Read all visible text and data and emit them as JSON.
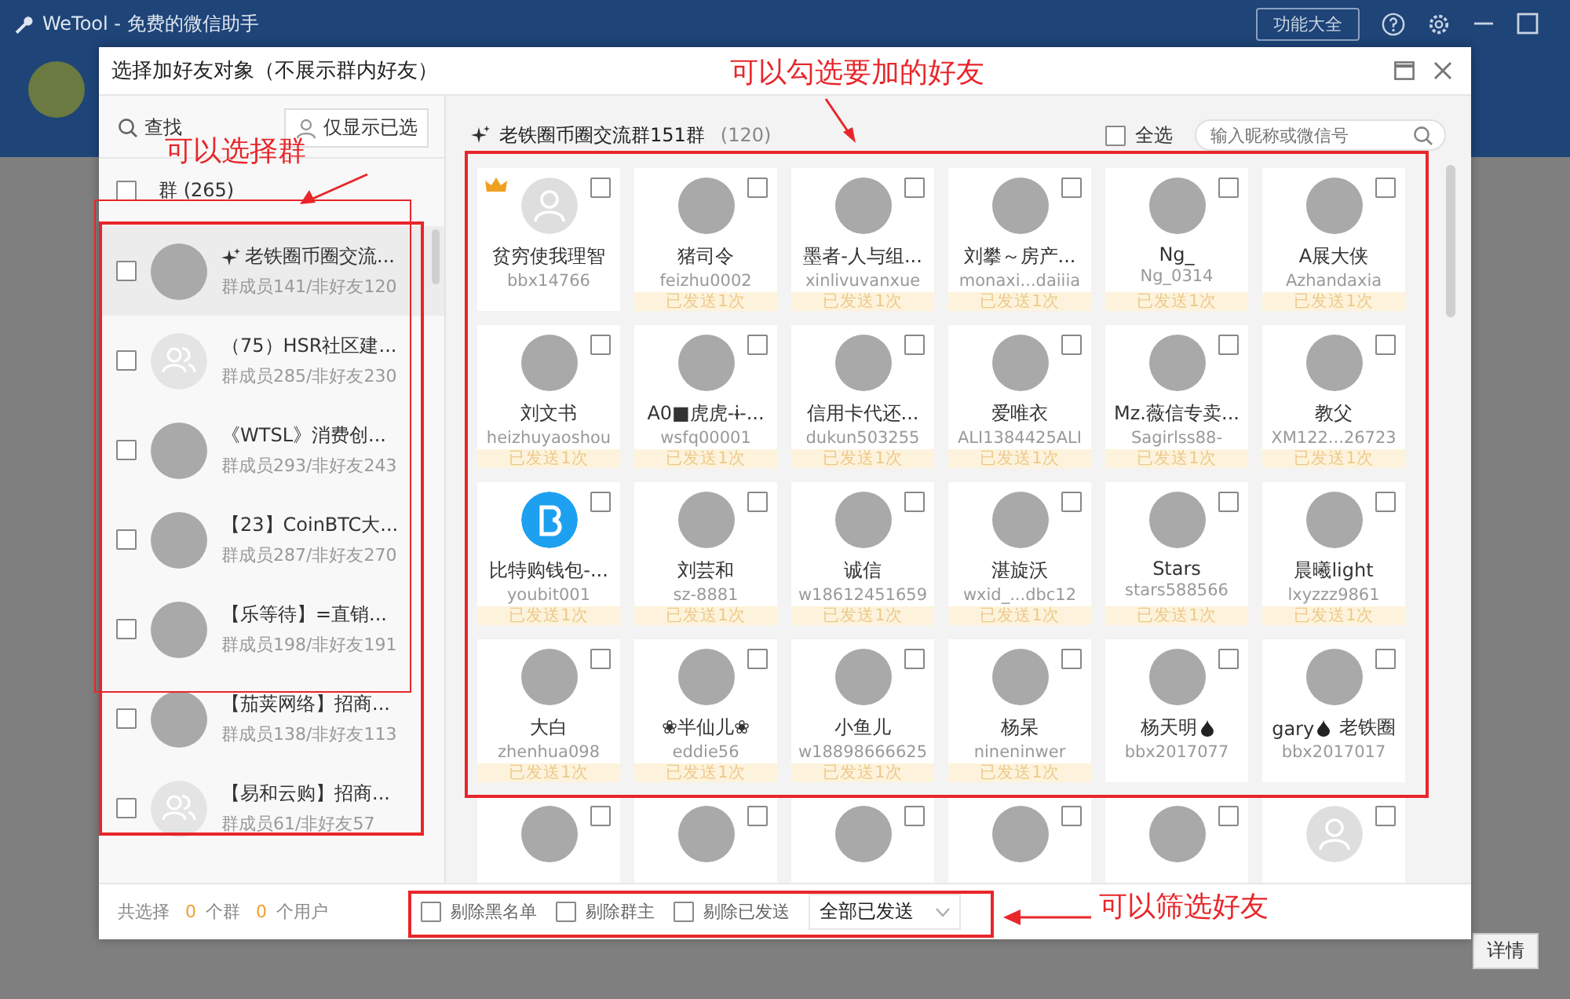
{
  "app": {
    "title": "WeTool - 免费的微信助手",
    "features_button": "功能大全",
    "details_button": "详情"
  },
  "dialog": {
    "title": "选择加好友对象（不展示群内好友）"
  },
  "left": {
    "search_label": "查找",
    "show_selected_button": "仅显示已选",
    "group_header": {
      "label": "群 (265)",
      "checked": false
    },
    "groups": [
      {
        "name": "老铁圈币圈交流...",
        "sub": "群成员141/非好友120",
        "sparkle": true,
        "kind": "photo",
        "checked": false,
        "selected": true
      },
      {
        "name": "（75）HSR社区建...",
        "sub": "群成员285/非好友230",
        "sparkle": false,
        "kind": "default",
        "checked": false,
        "selected": false
      },
      {
        "name": "《WTSL》消费创...",
        "sub": "群成员293/非好友243",
        "sparkle": false,
        "kind": "photo",
        "checked": false,
        "selected": false
      },
      {
        "name": "【23】CoinBTC大...",
        "sub": "群成员287/非好友270",
        "sparkle": false,
        "kind": "photo",
        "checked": false,
        "selected": false
      },
      {
        "name": "【乐等待】=直销...",
        "sub": "群成员198/非好友191",
        "sparkle": false,
        "kind": "photo",
        "checked": false,
        "selected": false
      },
      {
        "name": "【茄荚网络】招商...",
        "sub": "群成员138/非好友113",
        "sparkle": false,
        "kind": "photo",
        "checked": false,
        "selected": false
      },
      {
        "name": "【易和云购】招商...",
        "sub": "群成员61/非好友57",
        "sparkle": false,
        "kind": "default",
        "checked": false,
        "selected": false
      }
    ]
  },
  "right": {
    "group_title": "老铁圈币圈交流群151群",
    "count": "(120)",
    "select_all": {
      "label": "全选",
      "checked": false
    },
    "search_placeholder": "输入昵称或微信号",
    "friends": [
      {
        "name": "贫穷使我理智",
        "id": "bbx14766",
        "owner": true,
        "kind": "default",
        "checked": false
      },
      {
        "name": "猪司令",
        "id": "feizhu0002",
        "sent": "已发送1次",
        "kind": "photo",
        "checked": false
      },
      {
        "name": "墨者-人与组...",
        "id": "xinlivuvanxue",
        "sent": "已发送1次",
        "kind": "photo",
        "checked": false
      },
      {
        "name": "刘攀～房产...",
        "id": "monaxi...daiiia",
        "sent": "已发送1次",
        "kind": "photo",
        "checked": false
      },
      {
        "name": "Ng_",
        "id": "Ng_0314",
        "sent": "已发送1次",
        "kind": "photo",
        "checked": false
      },
      {
        "name": "A展大侠",
        "id": "Azhandaxia",
        "sent": "已发送1次",
        "kind": "photo",
        "checked": false
      },
      {
        "name": "刘文书",
        "id": "heizhuyaoshou",
        "sent": "已发送1次",
        "kind": "photo",
        "checked": false
      },
      {
        "name": "A0■虎虎-ɨ-...",
        "id": "wsfq00001",
        "sent": "已发送1次",
        "kind": "photo",
        "checked": false
      },
      {
        "name": "信用卡代还...",
        "id": "dukun503255",
        "sent": "已发送1次",
        "kind": "photo",
        "checked": false
      },
      {
        "name": "爱唯衣",
        "id": "ALI1384425ALI",
        "sent": "已发送1次",
        "kind": "photo",
        "checked": false
      },
      {
        "name": "Mz.薇信专卖...",
        "id": "Sagirlss88-",
        "sent": "已发送1次",
        "kind": "photo",
        "checked": false
      },
      {
        "name": "教父",
        "id": "XM122...26723",
        "sent": "已发送1次",
        "kind": "photo",
        "checked": false
      },
      {
        "name": "比特购钱包-...",
        "id": "youbit001",
        "sent": "已发送1次",
        "kind": "logo",
        "checked": false
      },
      {
        "name": "刘芸和",
        "id": "sz-8881",
        "sent": "已发送1次",
        "kind": "photo",
        "checked": false
      },
      {
        "name": "诚信",
        "id": "w18612451659",
        "sent": "已发送1次",
        "kind": "photo",
        "checked": false
      },
      {
        "name": "湛旋沃",
        "id": "wxid_...dbc12",
        "sent": "已发送1次",
        "kind": "photo",
        "checked": false
      },
      {
        "name": "Stars",
        "id": "stars588566",
        "sent": "已发送1次",
        "kind": "photo",
        "checked": false
      },
      {
        "name": "晨曦light",
        "id": "lxyzzz9861",
        "sent": "已发送1次",
        "kind": "photo",
        "checked": false
      },
      {
        "name": "大白",
        "id": "zhenhua098",
        "sent": "已发送1次",
        "kind": "photo",
        "checked": false
      },
      {
        "name": "❀半仙儿❀",
        "id": "eddie56",
        "sent": "已发送1次",
        "kind": "photo",
        "checked": false
      },
      {
        "name": "小鱼儿",
        "id": "w18898666625",
        "sent": "已发送1次",
        "kind": "photo",
        "checked": false
      },
      {
        "name": "杨杲",
        "id": "nineninwer",
        "sent": "已发送1次",
        "kind": "photo",
        "checked": false
      },
      {
        "name": "杨天明",
        "drop": true,
        "id": "bbx2017077",
        "kind": "photo",
        "checked": false
      },
      {
        "name": "gary",
        "drop": true,
        "suffix": " 老铁圈",
        "id": "bbx2017017",
        "kind": "photo",
        "checked": false
      },
      {
        "kind": "photo",
        "checked": false
      },
      {
        "kind": "photo",
        "checked": false
      },
      {
        "kind": "photo",
        "checked": false
      },
      {
        "kind": "photo",
        "checked": false
      },
      {
        "kind": "photo",
        "checked": false
      },
      {
        "kind": "default",
        "checked": false
      }
    ]
  },
  "bottom": {
    "selected_label": "共选择",
    "groups_count": "0",
    "groups_unit": "个群",
    "users_count": "0",
    "users_unit": "个用户",
    "filters": [
      {
        "label": "剔除黑名单",
        "checked": false
      },
      {
        "label": "剔除群主",
        "checked": false
      },
      {
        "label": "剔除已发送",
        "checked": false
      }
    ],
    "sent_filter": "全部已发送"
  },
  "annotations": [
    {
      "text": "可以勾选要加的好友"
    },
    {
      "text": "可以选择群"
    },
    {
      "text": "可以筛选好友"
    }
  ]
}
